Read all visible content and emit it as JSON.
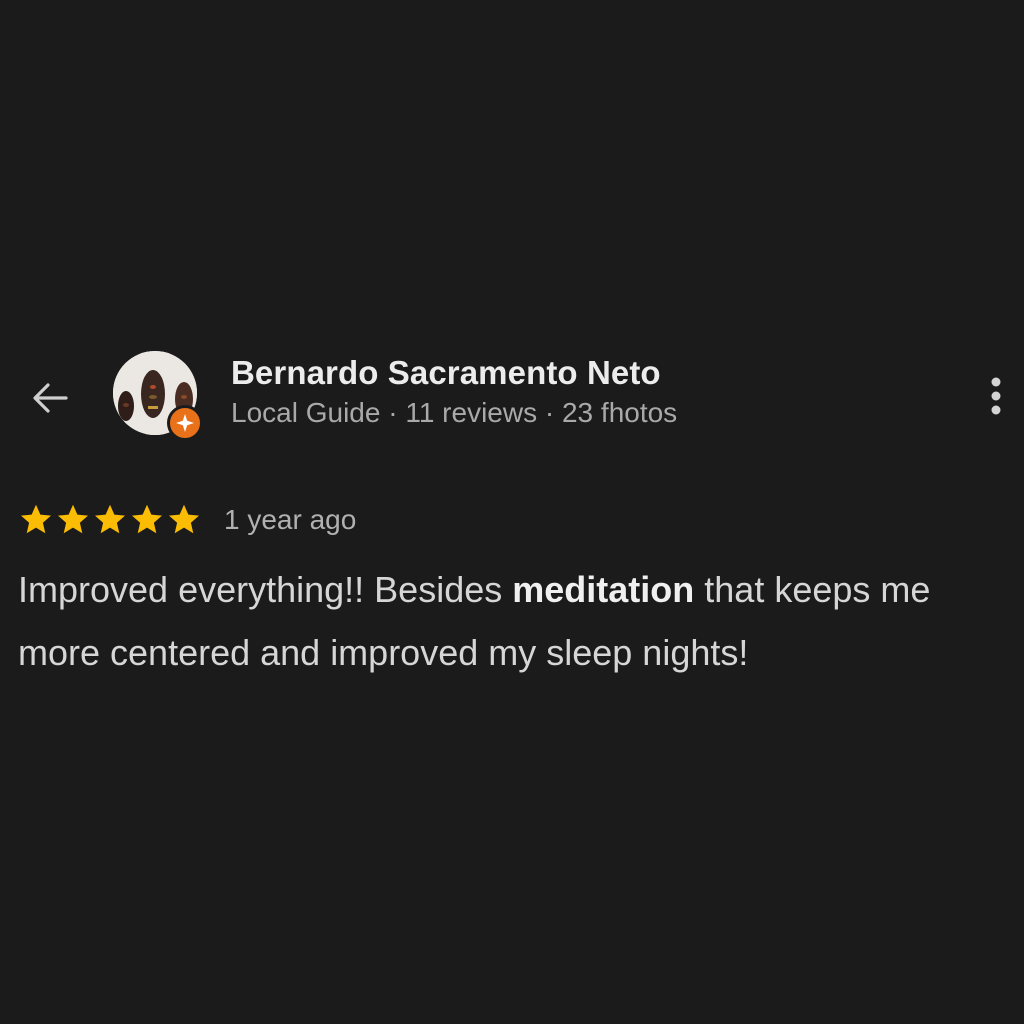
{
  "reviewer": {
    "name": "Bernardo Sacramento Neto",
    "badge": "Local Guide",
    "reviews": "11 reviews",
    "photos": "23 fhotos",
    "separator": "·",
    "avatar_icon": "avatar-photo",
    "badge_icon": "local-guide-star-icon"
  },
  "header": {
    "back_icon": "arrow-left-icon",
    "more_icon": "more-vert-icon"
  },
  "review": {
    "rating": 5,
    "rating_max": 5,
    "date": "1 year ago",
    "text_before": "Improved everything!! Besides ",
    "text_bold": "meditation",
    "text_after": " that keeps me more centered and improved my sleep nights!"
  },
  "colors": {
    "background": "#1c1b1c",
    "star": "#fbbc04",
    "badge": "#e8711a"
  }
}
